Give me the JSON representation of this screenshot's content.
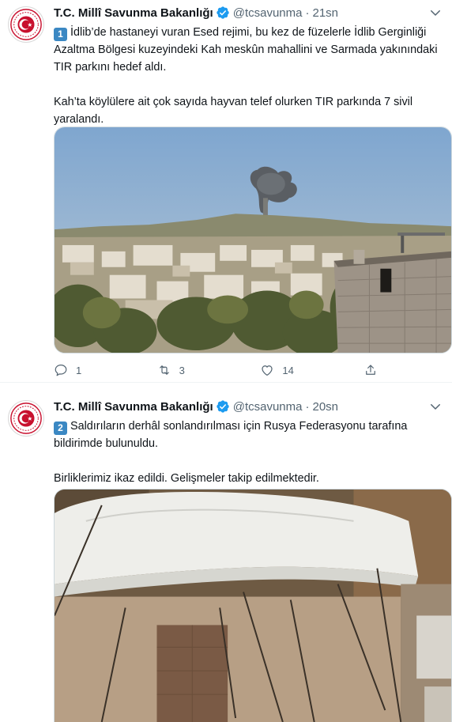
{
  "tweets": [
    {
      "author": "T.C. Millî Savunma Bakanlığı",
      "handle": "@tcsavunma",
      "separator": "·",
      "time": "21sn",
      "badge": "1",
      "paragraph1": "İdlib’de hastaneyi vuran Esed rejimi, bu kez de füzelerle İdlib Gerginliği Azaltma Bölgesi kuzeyindeki Kah meskûn mahallini ve Sarmada yakınındaki TIR parkını hedef aldı.",
      "paragraph2": "Kah’ta köylülere ait çok sayıda hayvan telef olurken TIR parkında 7 sivil yaralandı.",
      "stats": {
        "replies": "1",
        "retweets": "3",
        "likes": "14"
      }
    },
    {
      "author": "T.C. Millî Savunma Bakanlığı",
      "handle": "@tcsavunma",
      "separator": "·",
      "time": "20sn",
      "badge": "2",
      "paragraph1": "Saldırıların derhâl sonlandırılması için Rusya Federasyonu tarafına bildirimde bulunuldu.",
      "paragraph2": "Birliklerimiz ikaz edildi. Gelişmeler takip edilmektedir."
    }
  ],
  "icons": {
    "avatar": "msb-emblem-icon",
    "verified": "verified-badge-icon",
    "more": "chevron-down-icon",
    "reply": "reply-icon",
    "retweet": "retweet-icon",
    "like": "heart-icon",
    "share": "share-icon"
  },
  "colors": {
    "verified": "#1d9bf0",
    "badge": "#3b88c3",
    "emblem": "#c8102e",
    "secondary_text": "#536471"
  }
}
